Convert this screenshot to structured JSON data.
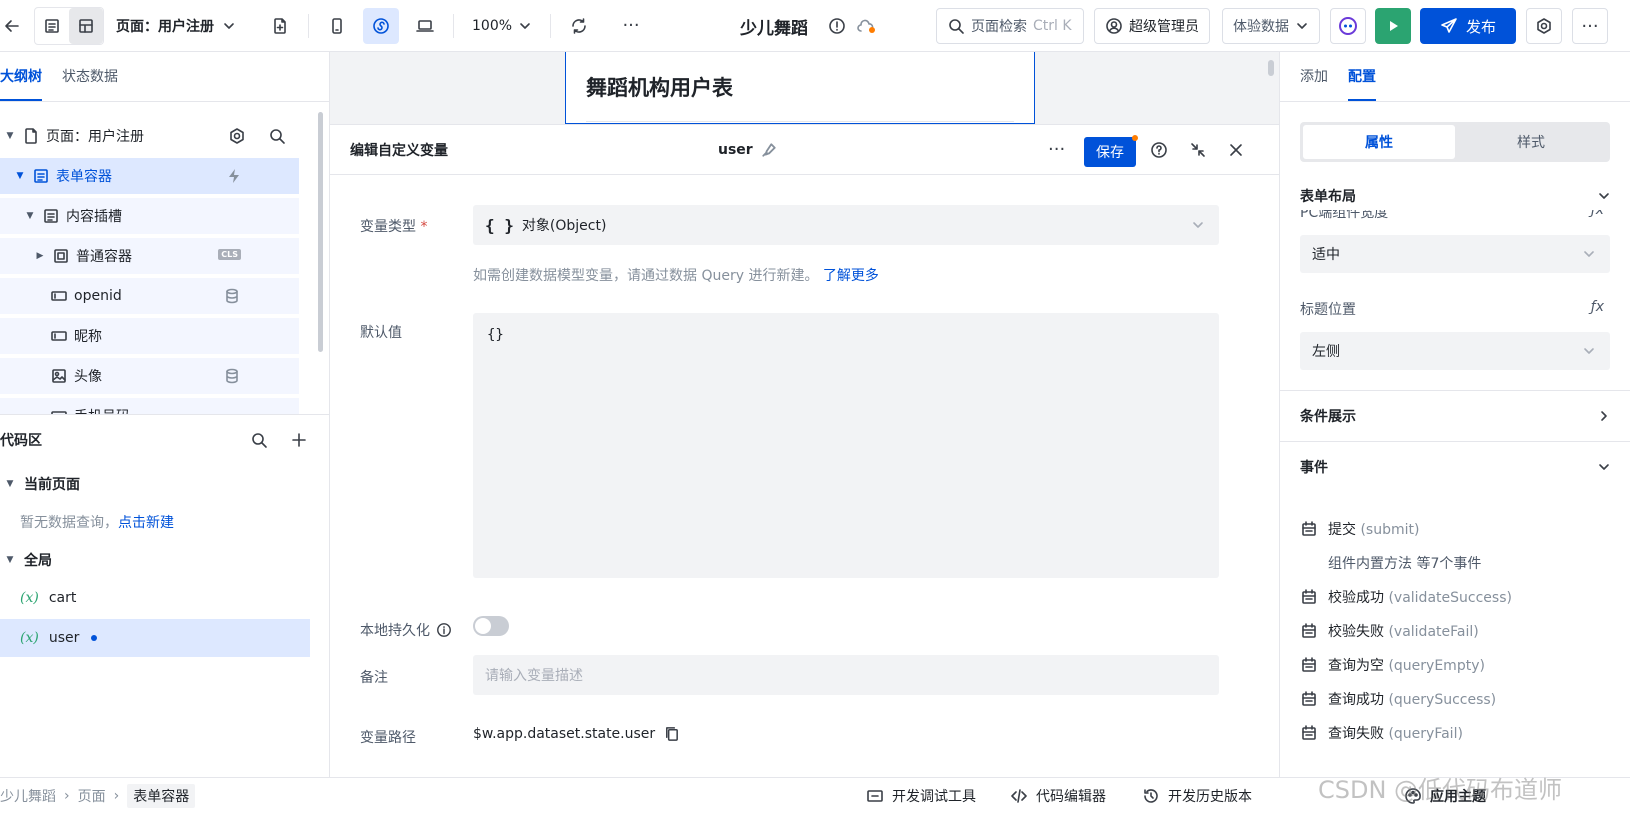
{
  "topbar": {
    "page_title": "页面：用户注册",
    "zoom": "100%",
    "app_name": "少儿舞蹈",
    "search_placeholder": "页面检索",
    "search_shortcut": "Ctrl K",
    "user_role": "超级管理员",
    "data_env": "体验数据",
    "publish_label": "发布"
  },
  "left": {
    "tabs": [
      "大纲树",
      "状态数据"
    ],
    "tree": [
      {
        "label": "页面：用户注册"
      },
      {
        "label": "表单容器"
      },
      {
        "label": "内容插槽"
      },
      {
        "label": "普通容器",
        "badge": "CLS"
      },
      {
        "label": "openid"
      },
      {
        "label": "昵称"
      },
      {
        "label": "头像"
      },
      {
        "label": "手机号码"
      }
    ],
    "code": {
      "title": "代码区",
      "current_page": "当前页面",
      "empty_text": "暂无数据查询，",
      "create_link": "点击新建",
      "global": "全局",
      "vars": [
        "cart",
        "user"
      ]
    }
  },
  "canvas": {
    "preview_title": "舞蹈机构用户表"
  },
  "dialog": {
    "title": "编辑自定义变量",
    "var_name": "user",
    "save_label": "保存",
    "type_label": "变量类型",
    "type_required": "*",
    "type_glyph": "{ }",
    "type_value": "对象(Object)",
    "hint": "如需创建数据模型变量，请通过数据 Query 进行新建。",
    "hint_link": "了解更多",
    "default_label": "默认值",
    "default_value": "{}",
    "persist_label": "本地持久化",
    "remark_label": "备注",
    "remark_placeholder": "请输入变量描述",
    "path_label": "变量路径",
    "path_value": "$w.app.dataset.state.user"
  },
  "right": {
    "tabs": [
      "添加",
      "配置"
    ],
    "seg": [
      "属性",
      "样式"
    ],
    "form_layout": "表单布局",
    "pc_width_partial": "PC端组件宽度",
    "pc_width_value": "适中",
    "title_pos_label": "标题位置",
    "title_pos_value": "左侧",
    "conditional": "条件展示",
    "events_title": "事件",
    "events": [
      {
        "cn": "提交",
        "en": "(submit)"
      },
      {
        "cn": "组件内置方法 等7个事件",
        "en": ""
      },
      {
        "cn": "校验成功",
        "en": "(validateSuccess)"
      },
      {
        "cn": "校验失败",
        "en": "(validateFail)"
      },
      {
        "cn": "查询为空",
        "en": "(queryEmpty)"
      },
      {
        "cn": "查询成功",
        "en": "(querySuccess)"
      },
      {
        "cn": "查询失败",
        "en": "(queryFail)"
      }
    ],
    "fx": "ƒx"
  },
  "status": {
    "breadcrumb": [
      "少儿舞蹈",
      "页面",
      "表单容器"
    ],
    "tools": [
      "开发调试工具",
      "代码编辑器",
      "开发历史版本"
    ],
    "theme": "应用主题",
    "watermark": "CSDN @低代码布道师"
  },
  "colors": {
    "accent": "#0052d9",
    "green": "#2ba471",
    "orange": "#ff7d00"
  }
}
